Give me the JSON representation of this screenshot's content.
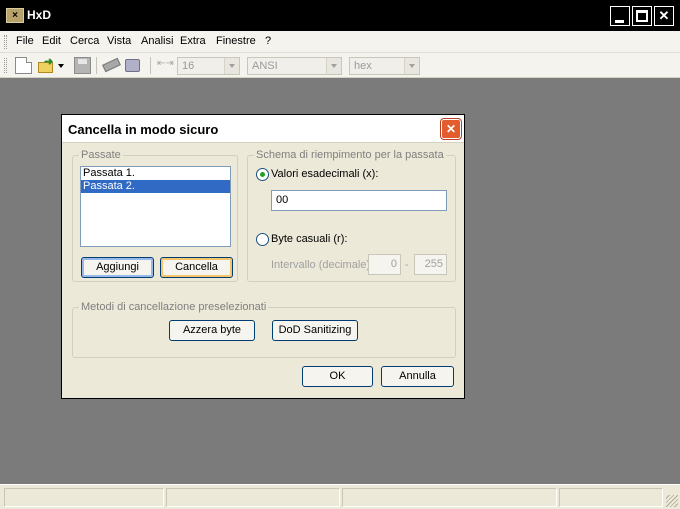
{
  "app": {
    "title": "HxD",
    "icon": "hxd-logo-icon"
  },
  "menu": {
    "items": [
      "File",
      "Edit",
      "Cerca",
      "Vista",
      "Analisi",
      "Extra",
      "Finestre",
      "?"
    ]
  },
  "toolbar": {
    "icons": [
      "new-file-icon",
      "open-file-icon",
      "save-icon",
      "open-ram-icon",
      "open-disk-icon",
      "bytes-per-row-icon"
    ],
    "bytes_per_row": "16",
    "charset": "ANSI",
    "offset_base": "hex"
  },
  "dialog": {
    "title": "Cancella in modo sicuro",
    "passes": {
      "legend": "Passate",
      "items": [
        "Passata 1.",
        "Passata 2."
      ],
      "selected_index": 1,
      "add_label": "Aggiungi",
      "delete_label": "Cancella"
    },
    "fill_scheme": {
      "legend": "Schema di riempimento per la passata",
      "hex_option_label": "Valori esadecimali (x):",
      "hex_selected": true,
      "hex_value": "00",
      "random_option_label": "Byte casuali (r):",
      "range_label": "Intervallo (decimale):",
      "range_min": "0",
      "range_separator": "-",
      "range_max": "255"
    },
    "presets": {
      "legend": "Metodi di cancellazione preselezionati",
      "zero_bytes_label": "Azzera byte",
      "dod_label": "DoD Sanitizing"
    },
    "ok_label": "OK",
    "cancel_label": "Annulla"
  },
  "colors": {
    "workspace": "#7b7b7b",
    "titlebar": "#000000",
    "dialog_background": "#ece9d8",
    "selection": "#316ac5",
    "close_button": "#e35c2e"
  }
}
